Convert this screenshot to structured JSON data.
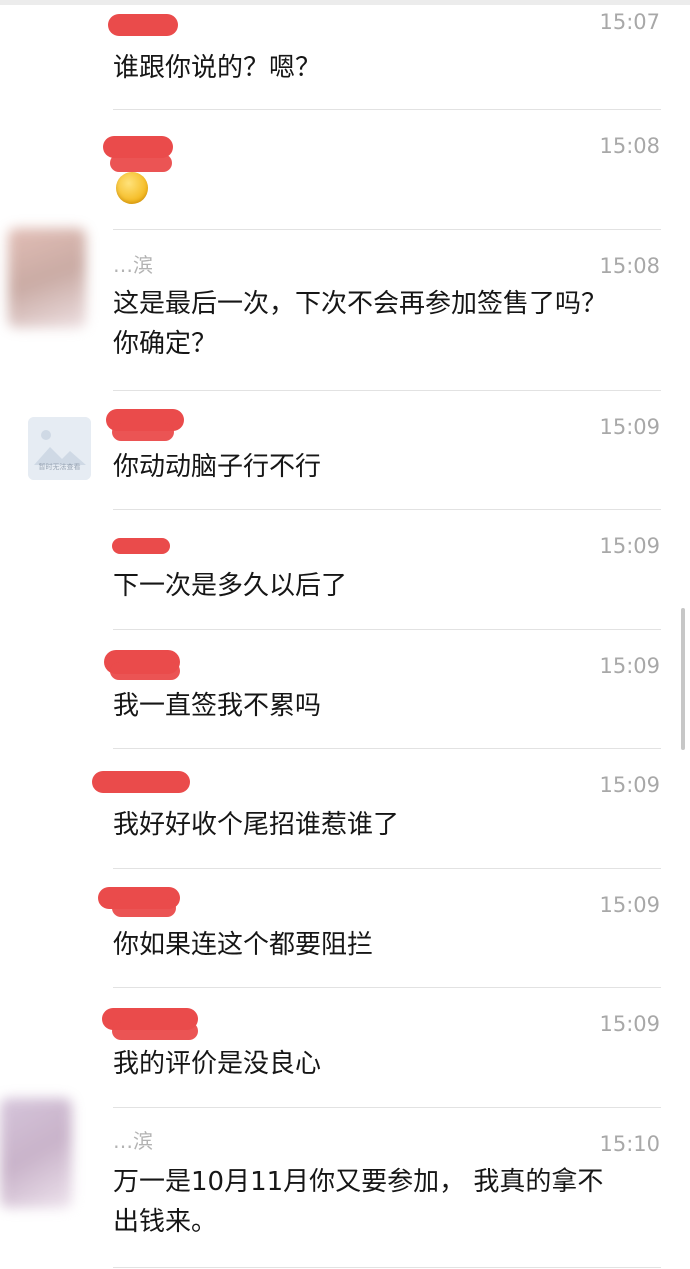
{
  "messages": [
    {
      "time": "15:07",
      "text": "谁跟你说的？嗯？"
    },
    {
      "time": "15:08",
      "text": "",
      "emoji": "smiling-face"
    },
    {
      "time": "15:08",
      "name_partial": "…滨",
      "text": "这是最后一次，下次不会再参加签售了吗？\n你确定？"
    },
    {
      "time": "15:09",
      "text": "你动动脑子行不行",
      "avatar_caption": "暂时无法查看"
    },
    {
      "time": "15:09",
      "text": "下一次是多久以后了"
    },
    {
      "time": "15:09",
      "text": "我一直签我不累吗"
    },
    {
      "time": "15:09",
      "text": "我好好收个尾招谁惹谁了"
    },
    {
      "time": "15:09",
      "text": "你如果连这个都要阻拦"
    },
    {
      "time": "15:09",
      "text": "我的评价是没良心"
    },
    {
      "time": "15:10",
      "name_partial": "…滨",
      "text": "万一是10月11月你又要参加， 我真的拿不\n出钱来。"
    }
  ],
  "colors": {
    "redaction": "#ea4b4b",
    "time": "#a8a8a8",
    "text": "#161616"
  }
}
